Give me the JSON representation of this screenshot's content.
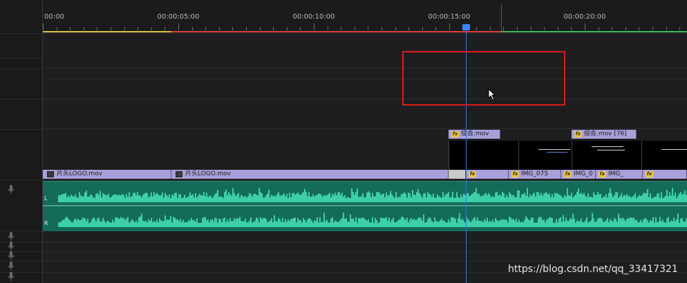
{
  "ruler": {
    "ticks": [
      "00:00",
      "00:00:05:00",
      "00:00:10:00",
      "00:00:15:00",
      "00:00:20:00"
    ]
  },
  "video_track_1": {
    "clips": [
      {
        "label": "综合.mov"
      },
      {
        "label": "综合.mov [76]"
      }
    ]
  },
  "video_track_2": {
    "clips": [
      {
        "label": "片头LOGO.mov"
      },
      {
        "label": "片头LOGO.mov"
      },
      {
        "label": "IMG_075"
      },
      {
        "label": "IMG_0"
      },
      {
        "label": "IMG_"
      }
    ]
  },
  "audio_track": {
    "left_channel": "L",
    "right_channel": "R",
    "color": "#1a8a6e"
  },
  "colors": {
    "playhead": "#3b78d8",
    "clip": "#a9a0d9",
    "highlight_box": "#e01b1b"
  },
  "watermark": "https://blog.csdn.net/qq_33417321"
}
